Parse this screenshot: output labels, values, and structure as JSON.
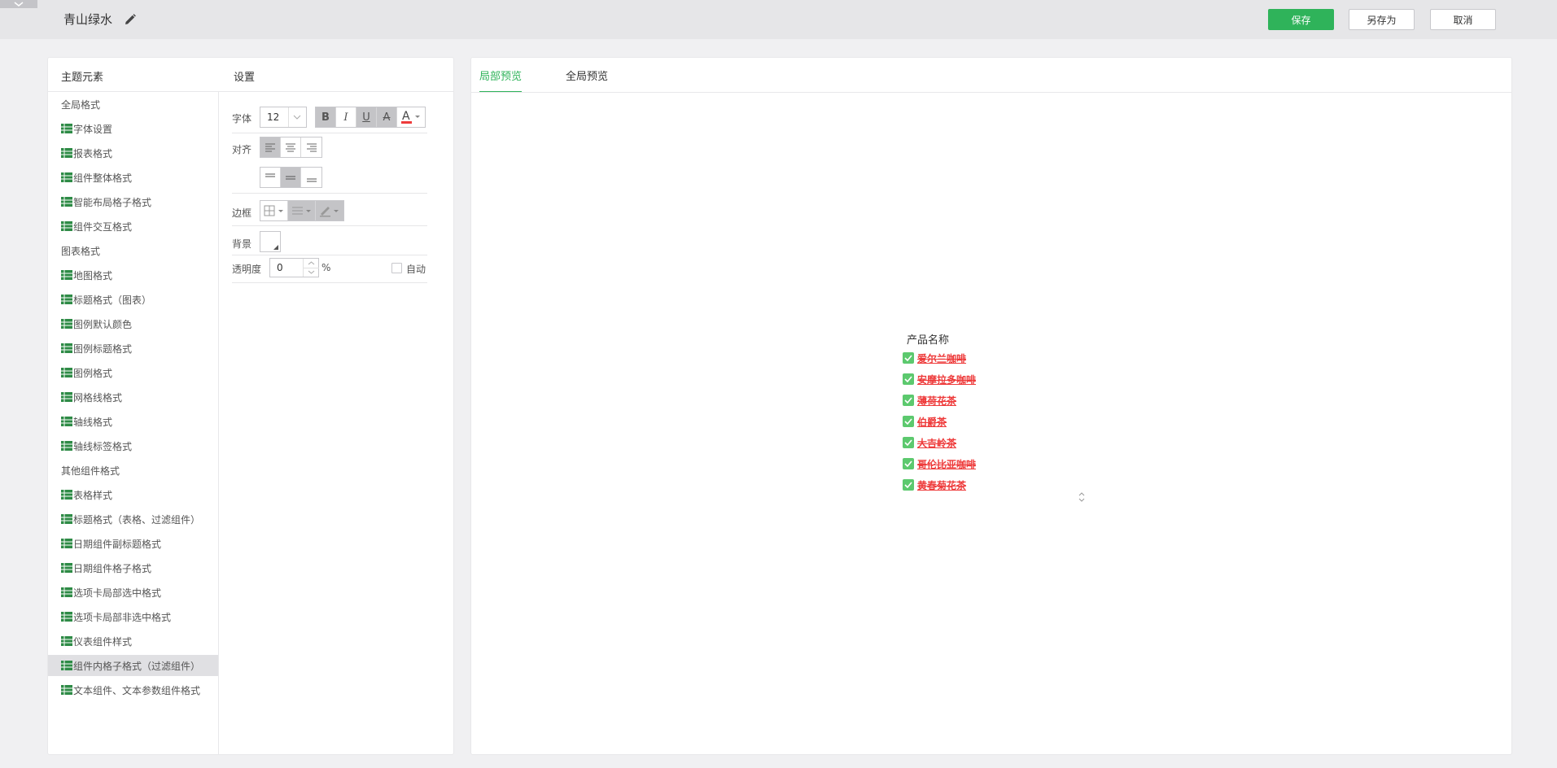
{
  "header": {
    "title": "青山绿水",
    "save_label": "保存",
    "save_as_label": "另存为",
    "cancel_label": "取消"
  },
  "left_panel": {
    "elements_title": "主题元素",
    "settings_title": "设置",
    "tree": [
      {
        "label": "全局格式",
        "type": "group"
      },
      {
        "label": "字体设置",
        "type": "leaf"
      },
      {
        "label": "报表格式",
        "type": "leaf"
      },
      {
        "label": "组件整体格式",
        "type": "leaf"
      },
      {
        "label": "智能布局格子格式",
        "type": "leaf"
      },
      {
        "label": "组件交互格式",
        "type": "leaf"
      },
      {
        "label": "图表格式",
        "type": "group"
      },
      {
        "label": "地图格式",
        "type": "leaf"
      },
      {
        "label": "标题格式（图表）",
        "type": "leaf"
      },
      {
        "label": "图例默认颜色",
        "type": "leaf"
      },
      {
        "label": "图例标题格式",
        "type": "leaf"
      },
      {
        "label": "图例格式",
        "type": "leaf"
      },
      {
        "label": "网格线格式",
        "type": "leaf"
      },
      {
        "label": "轴线格式",
        "type": "leaf"
      },
      {
        "label": "轴线标签格式",
        "type": "leaf"
      },
      {
        "label": "其他组件格式",
        "type": "group"
      },
      {
        "label": "表格样式",
        "type": "leaf"
      },
      {
        "label": "标题格式（表格、过滤组件）",
        "type": "leaf"
      },
      {
        "label": "日期组件副标题格式",
        "type": "leaf"
      },
      {
        "label": "日期组件格子格式",
        "type": "leaf"
      },
      {
        "label": "选项卡局部选中格式",
        "type": "leaf"
      },
      {
        "label": "选项卡局部非选中格式",
        "type": "leaf"
      },
      {
        "label": "仪表组件样式",
        "type": "leaf"
      },
      {
        "label": "组件内格子格式（过滤组件）",
        "type": "leaf",
        "selected": true
      },
      {
        "label": "文本组件、文本参数组件格式",
        "type": "leaf"
      }
    ]
  },
  "settings": {
    "font_label": "字体",
    "font_size": "12",
    "align_label": "对齐",
    "border_label": "边框",
    "background_label": "背景",
    "opacity_label": "透明度",
    "opacity_value": "0",
    "opacity_unit": "%",
    "auto_label": "自动"
  },
  "preview": {
    "tab_local": "局部预览",
    "tab_global": "全局预览",
    "title": "产品名称",
    "items": [
      "爱尔兰咖啡",
      "安摩拉多咖啡",
      "薄荷花茶",
      "伯爵茶",
      "大吉岭茶",
      "哥伦比亚咖啡",
      "黄春菊花茶"
    ],
    "accent_color": "#2fb35a",
    "item_color": "#ee3b3b"
  }
}
